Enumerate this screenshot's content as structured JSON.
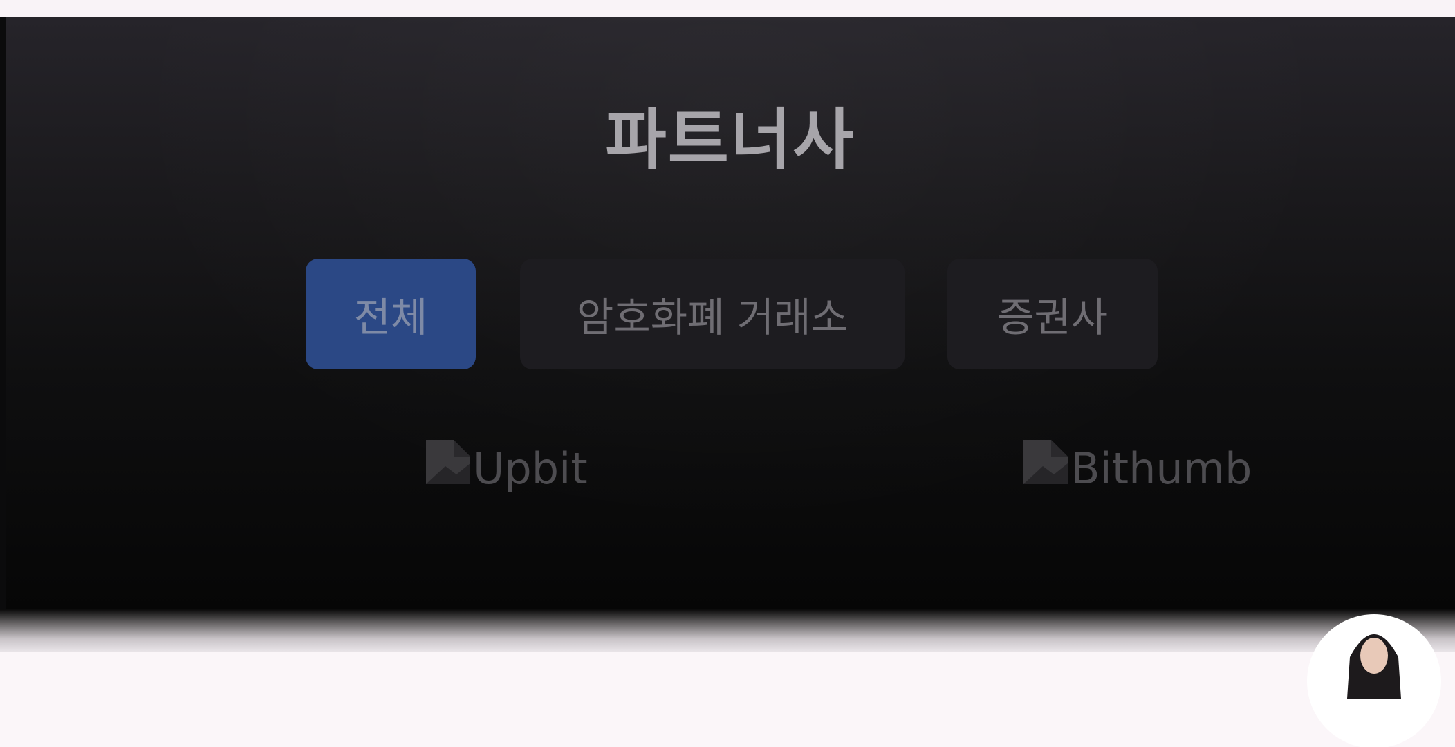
{
  "section": {
    "title": "파트너사"
  },
  "tabs": [
    {
      "label": "전체",
      "active": true
    },
    {
      "label": "암호화폐 거래소",
      "active": false
    },
    {
      "label": "증권사",
      "active": false
    }
  ],
  "partners": [
    {
      "alt": "Upbit",
      "icon": "broken-image-icon"
    },
    {
      "alt": "Bithumb",
      "icon": "broken-image-icon"
    }
  ],
  "colors": {
    "active_tab": "#2b4885",
    "inactive_tab": "#1d1c20",
    "title_text": "#a7a5aa",
    "panel_top": "#26242a",
    "panel_bottom": "#060606"
  }
}
